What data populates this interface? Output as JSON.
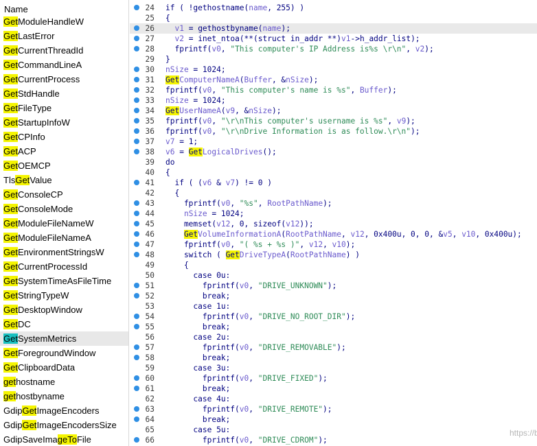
{
  "function_list": {
    "header": "Name",
    "selected_index": 22,
    "items": [
      {
        "prefix": "",
        "match": "Get",
        "suffix": "ModuleHandleW"
      },
      {
        "prefix": "",
        "match": "Get",
        "suffix": "LastError"
      },
      {
        "prefix": "",
        "match": "Get",
        "suffix": "CurrentThreadId"
      },
      {
        "prefix": "",
        "match": "Get",
        "suffix": "CommandLineA"
      },
      {
        "prefix": "",
        "match": "Get",
        "suffix": "CurrentProcess"
      },
      {
        "prefix": "",
        "match": "Get",
        "suffix": "StdHandle"
      },
      {
        "prefix": "",
        "match": "Get",
        "suffix": "FileType"
      },
      {
        "prefix": "",
        "match": "Get",
        "suffix": "StartupInfoW"
      },
      {
        "prefix": "",
        "match": "Get",
        "suffix": "CPInfo"
      },
      {
        "prefix": "",
        "match": "Get",
        "suffix": "ACP"
      },
      {
        "prefix": "",
        "match": "Get",
        "suffix": "OEMCP"
      },
      {
        "prefix": "Tls",
        "match": "Get",
        "suffix": "Value"
      },
      {
        "prefix": "",
        "match": "Get",
        "suffix": "ConsoleCP"
      },
      {
        "prefix": "",
        "match": "Get",
        "suffix": "ConsoleMode"
      },
      {
        "prefix": "",
        "match": "Get",
        "suffix": "ModuleFileNameW"
      },
      {
        "prefix": "",
        "match": "Get",
        "suffix": "ModuleFileNameA"
      },
      {
        "prefix": "",
        "match": "Get",
        "suffix": "EnvironmentStringsW"
      },
      {
        "prefix": "",
        "match": "Get",
        "suffix": "CurrentProcessId"
      },
      {
        "prefix": "",
        "match": "Get",
        "suffix": "SystemTimeAsFileTime"
      },
      {
        "prefix": "",
        "match": "Get",
        "suffix": "StringTypeW"
      },
      {
        "prefix": "",
        "match": "Get",
        "suffix": "DesktopWindow"
      },
      {
        "prefix": "",
        "match": "Get",
        "suffix": "DC"
      },
      {
        "prefix": "",
        "match": "Get",
        "suffix": "SystemMetrics"
      },
      {
        "prefix": "",
        "match": "Get",
        "suffix": "ForegroundWindow"
      },
      {
        "prefix": "",
        "match": "Get",
        "suffix": "ClipboardData"
      },
      {
        "prefix": "",
        "match": "get",
        "suffix": "hostname"
      },
      {
        "prefix": "",
        "match": "get",
        "suffix": "hostbyname"
      },
      {
        "prefix": "Gdip",
        "match": "Get",
        "suffix": "ImageEncoders"
      },
      {
        "prefix": "Gdip",
        "match": "Get",
        "suffix": "ImageEncodersSize"
      },
      {
        "prefix": "GdipSaveIma",
        "match": "geTo",
        "suffix": "File"
      }
    ]
  },
  "code": {
    "current_line": 26,
    "lines": [
      {
        "n": "24",
        "dot": true,
        "tokens": [
          [
            "t",
            "if ( !"
          ],
          [
            "t",
            "gethostname"
          ],
          [
            "t",
            "("
          ],
          [
            "v",
            "name"
          ],
          [
            "t",
            ", 255) )"
          ]
        ]
      },
      {
        "n": "25",
        "dot": false,
        "tokens": [
          [
            "t",
            "{"
          ]
        ]
      },
      {
        "n": "26",
        "dot": true,
        "tokens": [
          [
            "t",
            "  "
          ],
          [
            "v",
            "v1"
          ],
          [
            "t",
            " = "
          ],
          [
            "t",
            "gethostbyname"
          ],
          [
            "t",
            "("
          ],
          [
            "v",
            "name"
          ],
          [
            "t",
            ");"
          ]
        ]
      },
      {
        "n": "27",
        "dot": true,
        "tokens": [
          [
            "t",
            "  "
          ],
          [
            "v",
            "v2"
          ],
          [
            "t",
            " = "
          ],
          [
            "t",
            "inet_ntoa"
          ],
          [
            "t",
            "(**(struct in_addr **)"
          ],
          [
            "v",
            "v1"
          ],
          [
            "t",
            "->"
          ],
          [
            "t",
            "h_addr_list"
          ],
          [
            "t",
            ");"
          ]
        ]
      },
      {
        "n": "28",
        "dot": true,
        "tokens": [
          [
            "t",
            "  fprintf("
          ],
          [
            "v",
            "v0"
          ],
          [
            "t",
            ", "
          ],
          [
            "s",
            "\"This computer's IP Address is%s \\r\\n\""
          ],
          [
            "t",
            ", "
          ],
          [
            "v",
            "v2"
          ],
          [
            "t",
            ");"
          ]
        ]
      },
      {
        "n": "29",
        "dot": false,
        "tokens": [
          [
            "t",
            "}"
          ]
        ]
      },
      {
        "n": "30",
        "dot": true,
        "tokens": [
          [
            "v",
            "nSize"
          ],
          [
            "t",
            " = 1024;"
          ]
        ]
      },
      {
        "n": "31",
        "dot": true,
        "tokens": [
          [
            "h",
            "Get"
          ],
          [
            "v",
            "ComputerNameA"
          ],
          [
            "t",
            "("
          ],
          [
            "v",
            "Buffer"
          ],
          [
            "t",
            ", &"
          ],
          [
            "v",
            "nSize"
          ],
          [
            "t",
            ");"
          ]
        ]
      },
      {
        "n": "32",
        "dot": true,
        "tokens": [
          [
            "t",
            "fprintf("
          ],
          [
            "v",
            "v0"
          ],
          [
            "t",
            ", "
          ],
          [
            "s",
            "\"This computer's name is %s\""
          ],
          [
            "t",
            ", "
          ],
          [
            "v",
            "Buffer"
          ],
          [
            "t",
            ");"
          ]
        ]
      },
      {
        "n": "33",
        "dot": true,
        "tokens": [
          [
            "v",
            "nSize"
          ],
          [
            "t",
            " = 1024;"
          ]
        ]
      },
      {
        "n": "34",
        "dot": true,
        "tokens": [
          [
            "h",
            "Get"
          ],
          [
            "v",
            "UserNameA"
          ],
          [
            "t",
            "("
          ],
          [
            "v",
            "v9"
          ],
          [
            "t",
            ", &"
          ],
          [
            "v",
            "nSize"
          ],
          [
            "t",
            ");"
          ]
        ]
      },
      {
        "n": "35",
        "dot": true,
        "tokens": [
          [
            "t",
            "fprintf("
          ],
          [
            "v",
            "v0"
          ],
          [
            "t",
            ", "
          ],
          [
            "s",
            "\"\\r\\nThis computer's username is %s\""
          ],
          [
            "t",
            ", "
          ],
          [
            "v",
            "v9"
          ],
          [
            "t",
            ");"
          ]
        ]
      },
      {
        "n": "36",
        "dot": true,
        "tokens": [
          [
            "t",
            "fprintf("
          ],
          [
            "v",
            "v0"
          ],
          [
            "t",
            ", "
          ],
          [
            "s",
            "\"\\r\\nDrive Information is as follow.\\r\\n\""
          ],
          [
            "t",
            ");"
          ]
        ]
      },
      {
        "n": "37",
        "dot": true,
        "tokens": [
          [
            "v",
            "v7"
          ],
          [
            "t",
            " = 1;"
          ]
        ]
      },
      {
        "n": "38",
        "dot": true,
        "tokens": [
          [
            "v",
            "v6"
          ],
          [
            "t",
            " = "
          ],
          [
            "h",
            "Get"
          ],
          [
            "v",
            "LogicalDrives"
          ],
          [
            "t",
            "();"
          ]
        ]
      },
      {
        "n": "39",
        "dot": false,
        "tokens": [
          [
            "t",
            "do"
          ]
        ]
      },
      {
        "n": "40",
        "dot": false,
        "tokens": [
          [
            "t",
            "{"
          ]
        ]
      },
      {
        "n": "41",
        "dot": true,
        "tokens": [
          [
            "t",
            "  if ( ("
          ],
          [
            "v",
            "v6"
          ],
          [
            "t",
            " & "
          ],
          [
            "v",
            "v7"
          ],
          [
            "t",
            ") != 0 )"
          ]
        ]
      },
      {
        "n": "42",
        "dot": false,
        "tokens": [
          [
            "t",
            "  {"
          ]
        ]
      },
      {
        "n": "43",
        "dot": true,
        "tokens": [
          [
            "t",
            "    fprintf("
          ],
          [
            "v",
            "v0"
          ],
          [
            "t",
            ", "
          ],
          [
            "s",
            "\"%s\""
          ],
          [
            "t",
            ", "
          ],
          [
            "v",
            "RootPathName"
          ],
          [
            "t",
            ");"
          ]
        ]
      },
      {
        "n": "44",
        "dot": true,
        "tokens": [
          [
            "t",
            "    "
          ],
          [
            "v",
            "nSize"
          ],
          [
            "t",
            " = 1024;"
          ]
        ]
      },
      {
        "n": "45",
        "dot": true,
        "tokens": [
          [
            "t",
            "    memset("
          ],
          [
            "v",
            "v12"
          ],
          [
            "t",
            ", 0, sizeof("
          ],
          [
            "v",
            "v12"
          ],
          [
            "t",
            "));"
          ]
        ]
      },
      {
        "n": "46",
        "dot": true,
        "tokens": [
          [
            "t",
            "    "
          ],
          [
            "h",
            "Get"
          ],
          [
            "v",
            "VolumeInformationA"
          ],
          [
            "t",
            "("
          ],
          [
            "v",
            "RootPathName"
          ],
          [
            "t",
            ", "
          ],
          [
            "v",
            "v12"
          ],
          [
            "t",
            ", 0x400u, 0, 0, &"
          ],
          [
            "v",
            "v5"
          ],
          [
            "t",
            ", "
          ],
          [
            "v",
            "v10"
          ],
          [
            "t",
            ", 0x400u);"
          ]
        ]
      },
      {
        "n": "47",
        "dot": true,
        "tokens": [
          [
            "t",
            "    fprintf("
          ],
          [
            "v",
            "v0"
          ],
          [
            "t",
            ", "
          ],
          [
            "s",
            "\"( %s + %s )\""
          ],
          [
            "t",
            ", "
          ],
          [
            "v",
            "v12"
          ],
          [
            "t",
            ", "
          ],
          [
            "v",
            "v10"
          ],
          [
            "t",
            ");"
          ]
        ]
      },
      {
        "n": "48",
        "dot": true,
        "tokens": [
          [
            "t",
            "    switch ( "
          ],
          [
            "h",
            "Get"
          ],
          [
            "v",
            "DriveTypeA"
          ],
          [
            "t",
            "("
          ],
          [
            "v",
            "RootPathName"
          ],
          [
            "t",
            ") )"
          ]
        ]
      },
      {
        "n": "49",
        "dot": false,
        "tokens": [
          [
            "t",
            "    {"
          ]
        ]
      },
      {
        "n": "50",
        "dot": false,
        "tokens": [
          [
            "t",
            "      case 0u:"
          ]
        ]
      },
      {
        "n": "51",
        "dot": true,
        "tokens": [
          [
            "t",
            "        fprintf("
          ],
          [
            "v",
            "v0"
          ],
          [
            "t",
            ", "
          ],
          [
            "s",
            "\"DRIVE_UNKNOWN\""
          ],
          [
            "t",
            ");"
          ]
        ]
      },
      {
        "n": "52",
        "dot": true,
        "tokens": [
          [
            "t",
            "        break;"
          ]
        ]
      },
      {
        "n": "53",
        "dot": false,
        "tokens": [
          [
            "t",
            "      case 1u:"
          ]
        ]
      },
      {
        "n": "54",
        "dot": true,
        "tokens": [
          [
            "t",
            "        fprintf("
          ],
          [
            "v",
            "v0"
          ],
          [
            "t",
            ", "
          ],
          [
            "s",
            "\"DRIVE_NO_ROOT_DIR\""
          ],
          [
            "t",
            ");"
          ]
        ]
      },
      {
        "n": "55",
        "dot": true,
        "tokens": [
          [
            "t",
            "        break;"
          ]
        ]
      },
      {
        "n": "56",
        "dot": false,
        "tokens": [
          [
            "t",
            "      case 2u:"
          ]
        ]
      },
      {
        "n": "57",
        "dot": true,
        "tokens": [
          [
            "t",
            "        fprintf("
          ],
          [
            "v",
            "v0"
          ],
          [
            "t",
            ", "
          ],
          [
            "s",
            "\"DRIVE_REMOVABLE\""
          ],
          [
            "t",
            ");"
          ]
        ]
      },
      {
        "n": "58",
        "dot": true,
        "tokens": [
          [
            "t",
            "        break;"
          ]
        ]
      },
      {
        "n": "59",
        "dot": false,
        "tokens": [
          [
            "t",
            "      case 3u:"
          ]
        ]
      },
      {
        "n": "60",
        "dot": true,
        "tokens": [
          [
            "t",
            "        fprintf("
          ],
          [
            "v",
            "v0"
          ],
          [
            "t",
            ", "
          ],
          [
            "s",
            "\"DRIVE_FIXED\""
          ],
          [
            "t",
            ");"
          ]
        ]
      },
      {
        "n": "61",
        "dot": true,
        "tokens": [
          [
            "t",
            "        break;"
          ]
        ]
      },
      {
        "n": "62",
        "dot": false,
        "tokens": [
          [
            "t",
            "      case 4u:"
          ]
        ]
      },
      {
        "n": "63",
        "dot": true,
        "tokens": [
          [
            "t",
            "        fprintf("
          ],
          [
            "v",
            "v0"
          ],
          [
            "t",
            ", "
          ],
          [
            "s",
            "\"DRIVE_REMOTE\""
          ],
          [
            "t",
            ");"
          ]
        ]
      },
      {
        "n": "64",
        "dot": true,
        "tokens": [
          [
            "t",
            "        break;"
          ]
        ]
      },
      {
        "n": "65",
        "dot": false,
        "tokens": [
          [
            "t",
            "      case 5u:"
          ]
        ]
      },
      {
        "n": "66",
        "dot": true,
        "tokens": [
          [
            "t",
            "        fprintf("
          ],
          [
            "v",
            "v0"
          ],
          [
            "t",
            ", "
          ],
          [
            "s",
            "\"DRIVE_CDROM\""
          ],
          [
            "t",
            ");"
          ]
        ]
      }
    ]
  },
  "watermark": "https://blog.csdn.net/JiangBuLiu",
  "colors": {
    "match_highlight": "#f5f500",
    "selected_match_highlight": "#19c0c0",
    "breakpoint_dot": "#2f8fe4",
    "variable": "#6a5acd",
    "string": "#2e8b57",
    "keyword_text": "#000080"
  },
  "icons": {
    "breakpoint": "dot-icon"
  }
}
